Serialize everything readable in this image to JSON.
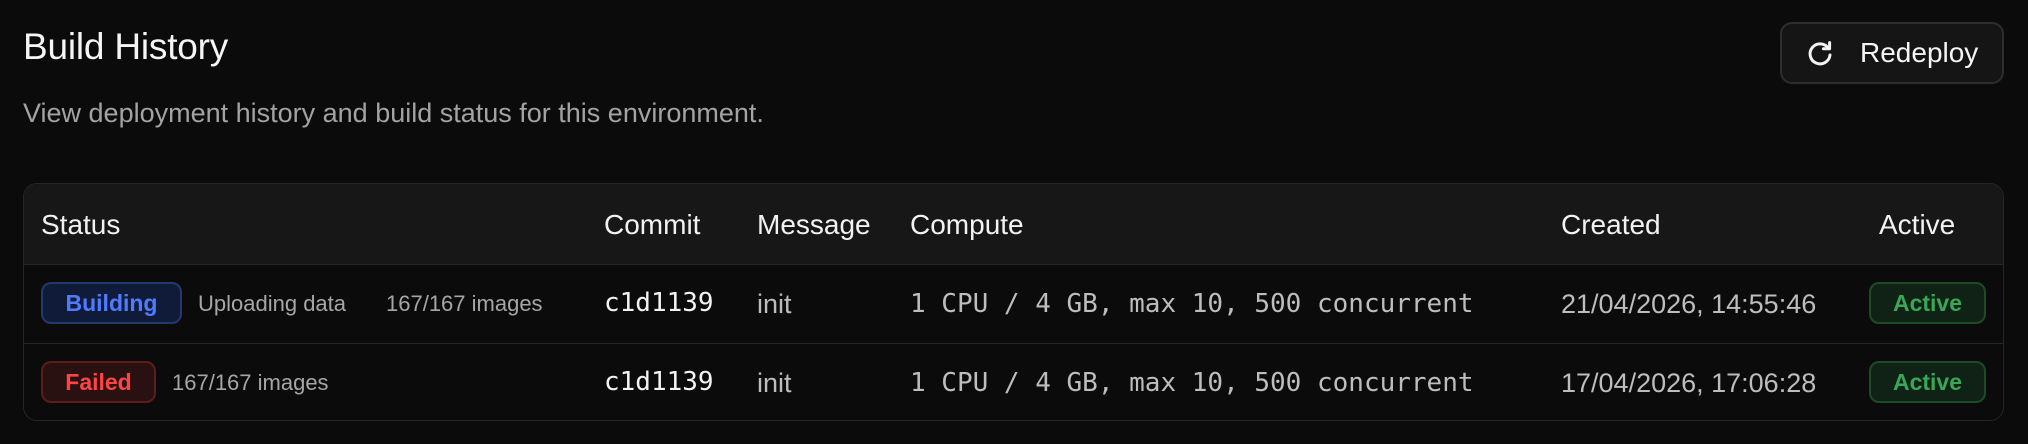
{
  "header": {
    "title": "Build History",
    "subtitle": "View deployment history and build status for this environment.",
    "redeploy_label": "Redeploy"
  },
  "table": {
    "columns": [
      "Status",
      "Commit",
      "Message",
      "Compute",
      "Created",
      "Active"
    ],
    "rows": [
      {
        "status": "Building",
        "progress_stage": "Uploading data",
        "progress_count": "167/167 images",
        "commit": "c1d1139",
        "message": "init",
        "compute": "1 CPU / 4 GB, max 10, 500 concurrent",
        "created": "21/04/2026, 14:55:46",
        "active": "Active"
      },
      {
        "status": "Failed",
        "progress_count": "167/167 images",
        "commit": "c1d1139",
        "message": "init",
        "compute": "1 CPU / 4 GB, max 10, 500 concurrent",
        "created": "17/04/2026, 17:06:28",
        "active": "Active"
      }
    ]
  },
  "colors": {
    "background": "#0b0b0b",
    "building_blue": "#4f7cff",
    "failed_red": "#ff4444",
    "active_green": "#3aa657"
  },
  "icons": {
    "redeploy": "refresh-icon"
  }
}
